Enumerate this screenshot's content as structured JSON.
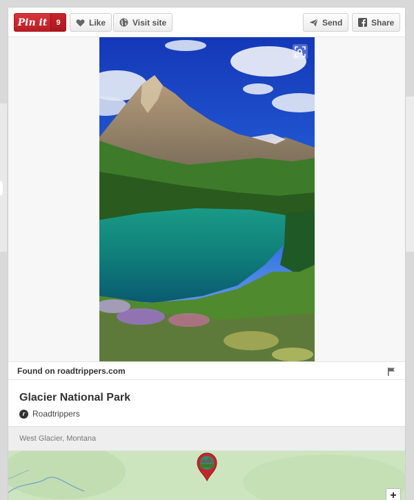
{
  "toolbar": {
    "pinit_label": "Pin it",
    "pinit_count": "9",
    "like_label": "Like",
    "visit_label": "Visit site",
    "send_label": "Send",
    "share_label": "Share"
  },
  "pin": {
    "found_on": "Found on roadtrippers.com",
    "title": "Glacier National Park",
    "source_name": "Roadtrippers",
    "location": "West Glacier, Montana"
  },
  "map": {
    "zoom_in_label": "+"
  },
  "icons": {
    "like": "heart-icon",
    "visit": "globe-icon",
    "send": "paper-plane-icon",
    "share": "facebook-icon",
    "expand": "expand-icon",
    "flag": "flag-icon",
    "marker": "map-marker-icon"
  },
  "colors": {
    "pinterest_red": "#cb2027",
    "map_green": "#cde5bf",
    "location_bar": "#eeeeee"
  }
}
